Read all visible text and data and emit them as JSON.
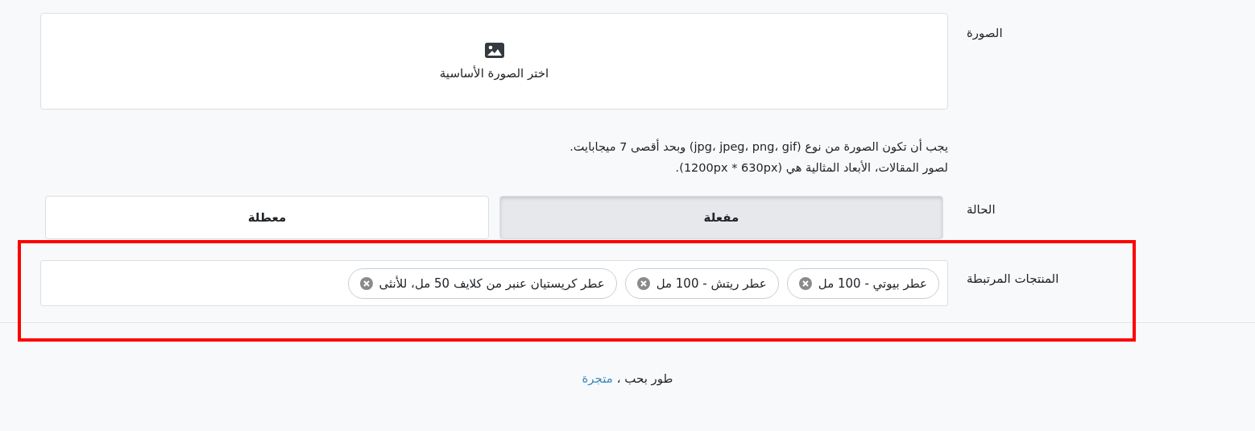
{
  "image_field": {
    "label": "الصورة",
    "button_text": "اختر الصورة الأساسية",
    "help_lines": [
      "يجب أن تكون الصورة من نوع (jpg، jpeg، png، gif) وبحد أقصى 7 ميجابايت.",
      "لصور المقالات، الأبعاد المثالية هي (1200px * 630px)."
    ]
  },
  "status": {
    "label": "الحالة",
    "options": [
      {
        "label": "مفعلة",
        "selected": true
      },
      {
        "label": "معطلة",
        "selected": false
      }
    ]
  },
  "related_products": {
    "label": "المنتجات المرتبطة",
    "highlighted": true,
    "tags": [
      {
        "label": "عطر بيوتي - 100 مل"
      },
      {
        "label": "عطر ريتش - 100 مل"
      },
      {
        "label": "عطر كريستيان عنبر من كلايف 50 مل، للأنثى"
      }
    ]
  },
  "footer": {
    "text": "طور بحب ، ",
    "link": "متجرة"
  }
}
